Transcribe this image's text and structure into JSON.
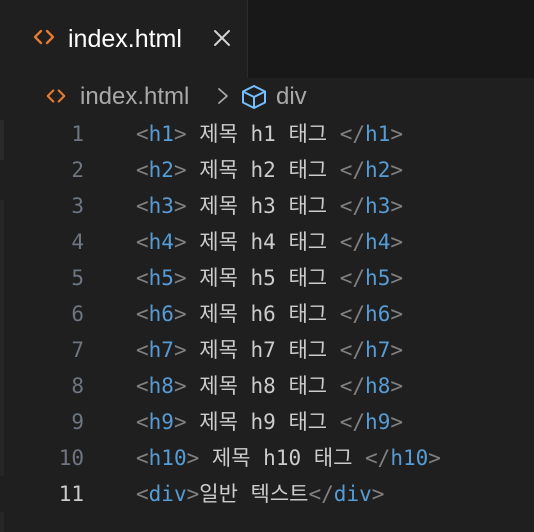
{
  "tab": {
    "label": "index.html",
    "close_icon": "close-icon",
    "file_icon": "html-file-icon",
    "icon_color": "#e37933"
  },
  "breadcrumb": {
    "file": "index.html",
    "element": "div",
    "element_icon": "cube-icon"
  },
  "editor": {
    "active_line": 11,
    "lines": [
      {
        "number": "1",
        "open": "h1",
        "content": " 제목 h1 태그 ",
        "close": "h1"
      },
      {
        "number": "2",
        "open": "h2",
        "content": " 제목 h2 태그 ",
        "close": "h2"
      },
      {
        "number": "3",
        "open": "h3",
        "content": " 제목 h3 태그 ",
        "close": "h3"
      },
      {
        "number": "4",
        "open": "h4",
        "content": " 제목 h4 태그 ",
        "close": "h4"
      },
      {
        "number": "5",
        "open": "h5",
        "content": " 제목 h5 태그 ",
        "close": "h5"
      },
      {
        "number": "6",
        "open": "h6",
        "content": " 제목 h6 태그 ",
        "close": "h6"
      },
      {
        "number": "7",
        "open": "h7",
        "content": " 제목 h7 태그 ",
        "close": "h7"
      },
      {
        "number": "8",
        "open": "h8",
        "content": " 제목 h8 태그 ",
        "close": "h8"
      },
      {
        "number": "9",
        "open": "h9",
        "content": " 제목 h9 태그 ",
        "close": "h9"
      },
      {
        "number": "10",
        "open": "h10",
        "content": " 제목 h10 태그 ",
        "close": "h10"
      },
      {
        "number": "11",
        "open": "div",
        "content": "일반 텍스트",
        "close": "div"
      }
    ]
  },
  "colors": {
    "background": "#1f1f1f",
    "tag": "#569cd6",
    "punctuation": "#808080",
    "text": "#cccccc",
    "line_number": "#6e7681",
    "active_line_number": "#cccccc"
  }
}
